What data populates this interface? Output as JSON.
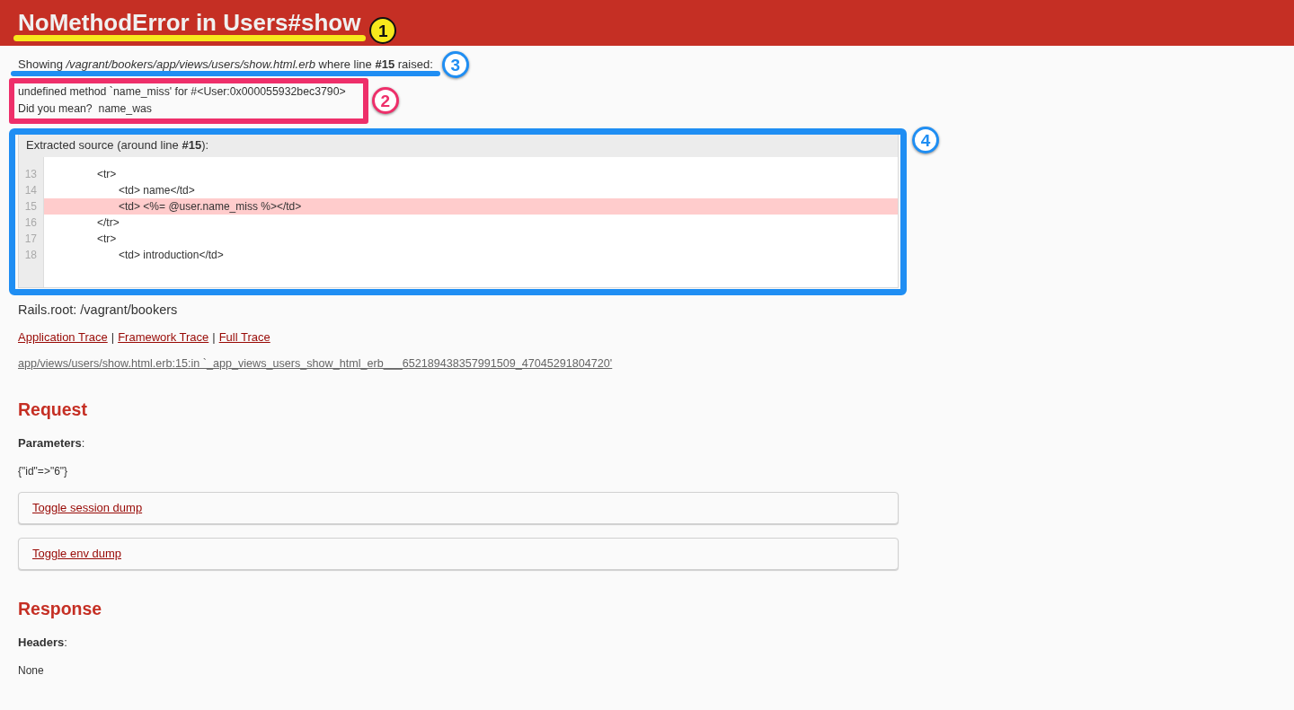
{
  "header": {
    "title": "NoMethodError in Users#show",
    "annotation": {
      "kind": "underline",
      "color": "#f7e81c",
      "callout": {
        "kind": "filled",
        "label": "1"
      }
    }
  },
  "showing": {
    "text": "Showing */vagrant/bookers/app/views/users/show.html.erb* where line **#15** raised:",
    "annotation": {
      "kind": "underline",
      "color": "#1f8ef3",
      "callout": {
        "kind": "outlined",
        "label": "3"
      }
    }
  },
  "message": {
    "lines": [
      "undefined method `name_miss' for #<User:0x000055932bec3790>",
      "Did you mean?  name_was"
    ],
    "annotation": {
      "kind": "frame",
      "color": "#ee2f6a",
      "callout": {
        "kind": "outlined",
        "label": "2"
      }
    }
  },
  "source_extract": {
    "title": "Extracted source (around line **#15**):",
    "lines": [
      {
        "number": "13",
        "code": "\t\t<tr>",
        "highlighted": false
      },
      {
        "number": "14",
        "code": "\t\t\t<td> name</td>",
        "highlighted": false
      },
      {
        "number": "15",
        "code": "\t\t\t<td> <%= @user.name_miss %></td>",
        "highlighted": true
      },
      {
        "number": "16",
        "code": "\t\t</tr>",
        "highlighted": false
      },
      {
        "number": "17",
        "code": "\t\t<tr>",
        "highlighted": false
      },
      {
        "number": "18",
        "code": "\t\t\t<td> introduction</td>",
        "highlighted": false
      }
    ],
    "annotation": {
      "kind": "frame",
      "color": "#1f8ef3",
      "callout": {
        "kind": "outlined",
        "label": "4"
      }
    }
  },
  "rails_root": "Rails.root: /vagrant/bookers",
  "trace_links": [
    {
      "kind": "link",
      "label": "Application Trace"
    },
    {
      "kind": "separator",
      "label": "|"
    },
    {
      "kind": "link",
      "label": "Framework Trace"
    },
    {
      "kind": "separator",
      "label": "|"
    },
    {
      "kind": "link",
      "label": "Full Trace"
    }
  ],
  "trace_entries": [
    "app/views/users/show.html.erb:15:in `_app_views_users_show_html_erb___652189438357991509_47045291804720'"
  ],
  "request": {
    "heading": "Request",
    "parameters_label": "**Parameters**:",
    "parameters": "{\"id\"=>\"6\"}",
    "dumps": [
      "Toggle session dump",
      "Toggle env dump"
    ]
  },
  "response": {
    "heading": "Response",
    "headers_label": "**Headers**:",
    "headers": "None"
  }
}
